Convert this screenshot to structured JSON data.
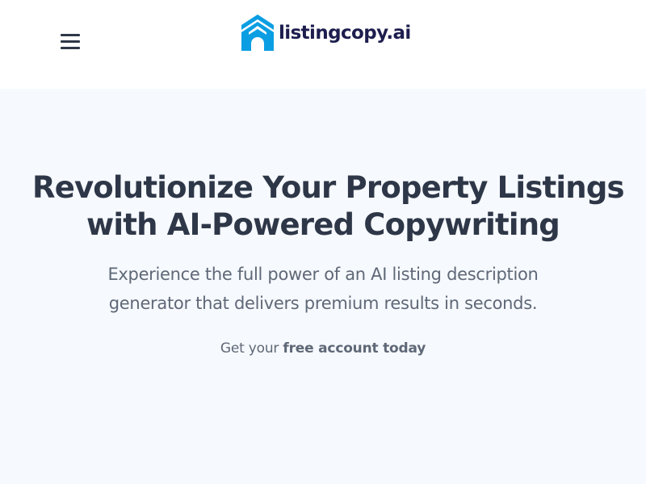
{
  "colors": {
    "brand_blue": "#0b9ee3",
    "brand_text": "#1d1e4e",
    "heading": "#2e3748",
    "body_text": "#5f6877",
    "hero_background": "#f6f9fd",
    "header_background": "#ffffff"
  },
  "header": {
    "menu_icon": "hamburger-menu-icon",
    "logo_icon": "house-logo-icon",
    "brand_name": "listingcopy.ai"
  },
  "hero": {
    "title_line_1": "Revolutionize Your Property Listings",
    "title_line_2": "with AI-Powered Copywriting",
    "subtitle_line_1": "Experience the full power of an AI listing description",
    "subtitle_line_2": "generator that delivers premium results in seconds.",
    "cta_prefix": "Get your ",
    "cta_link": "free account today"
  }
}
